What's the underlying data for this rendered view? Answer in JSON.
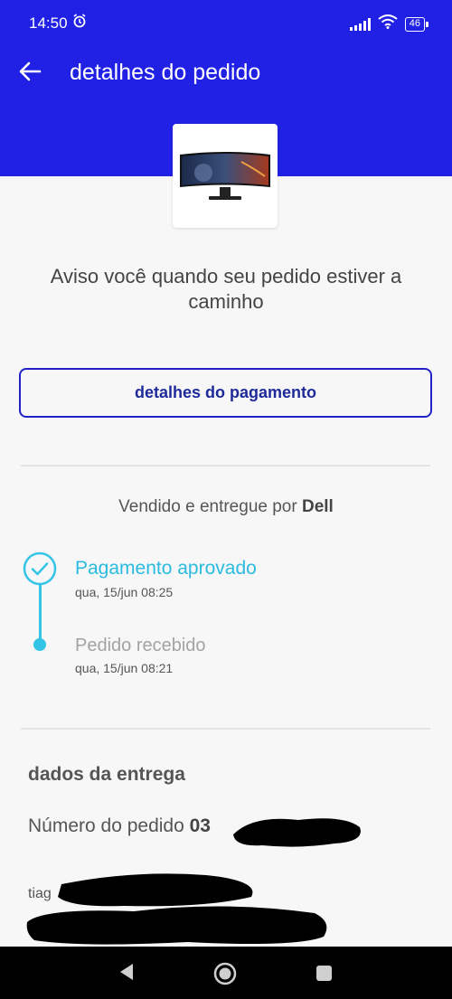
{
  "status_bar": {
    "time": "14:50",
    "battery": "46"
  },
  "app_bar": {
    "title": "detalhes do pedido"
  },
  "colors": {
    "primary": "#2121e6",
    "accent": "#2bbbe0",
    "button_text": "#1e2a9a"
  },
  "product": {
    "image_icon": "monitor-icon"
  },
  "notice": "Aviso você quando seu pedido estiver a caminho",
  "payment_button": "detalhes do pagamento",
  "seller": {
    "prefix": "Vendido e entregue por ",
    "name": "Dell"
  },
  "timeline": [
    {
      "title": "Pagamento aprovado",
      "date": "qua, 15/jun 08:25"
    },
    {
      "title": "Pedido recebido",
      "date": "qua, 15/jun 08:21"
    }
  ],
  "delivery": {
    "title": "dados da entrega",
    "order_label": "Número do pedido ",
    "order_number_visible": "03",
    "customer_name_visible": "tiag"
  }
}
